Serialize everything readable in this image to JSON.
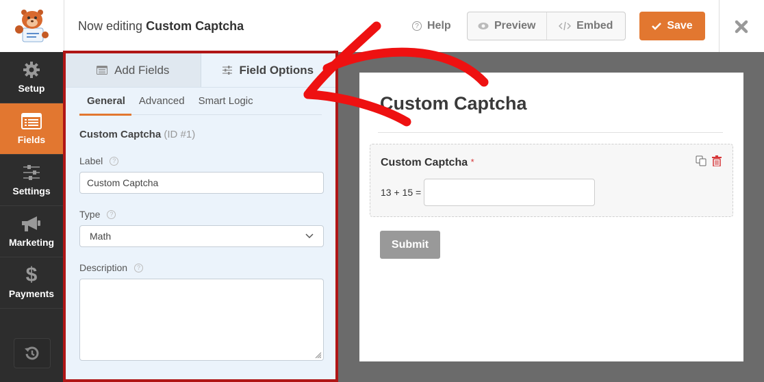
{
  "header": {
    "title_prefix": "Now editing",
    "form_name": "Custom Captcha",
    "help_label": "Help",
    "preview_label": "Preview",
    "embed_label": "Embed",
    "save_label": "Save"
  },
  "sidebar": {
    "items": [
      {
        "label": "Setup",
        "icon": "gear-icon",
        "active": false
      },
      {
        "label": "Fields",
        "icon": "fields-list-icon",
        "active": true
      },
      {
        "label": "Settings",
        "icon": "sliders-icon",
        "active": false
      },
      {
        "label": "Marketing",
        "icon": "megaphone-icon",
        "active": false
      },
      {
        "label": "Payments",
        "icon": "dollar-icon",
        "active": false
      }
    ],
    "revisions_icon": "history-icon"
  },
  "panel": {
    "tabs": [
      {
        "label": "Add Fields",
        "active": false
      },
      {
        "label": "Field Options",
        "active": true
      }
    ],
    "subtabs": [
      {
        "label": "General",
        "active": true
      },
      {
        "label": "Advanced",
        "active": false
      },
      {
        "label": "Smart Logic",
        "active": false
      }
    ],
    "field_name": "Custom Captcha",
    "field_id": "(ID #1)",
    "label_caption": "Label",
    "label_value": "Custom Captcha",
    "type_caption": "Type",
    "type_value": "Math",
    "description_caption": "Description",
    "description_value": "",
    "help_glyph": "?"
  },
  "preview": {
    "form_title": "Custom Captcha",
    "field_label": "Custom Captcha",
    "required_mark": "*",
    "equation": "13 + 15 =",
    "answer_value": "",
    "submit_label": "Submit"
  },
  "colors": {
    "accent": "#e27730",
    "highlight_border": "#b01616",
    "annotation_arrow": "#ee1111"
  }
}
